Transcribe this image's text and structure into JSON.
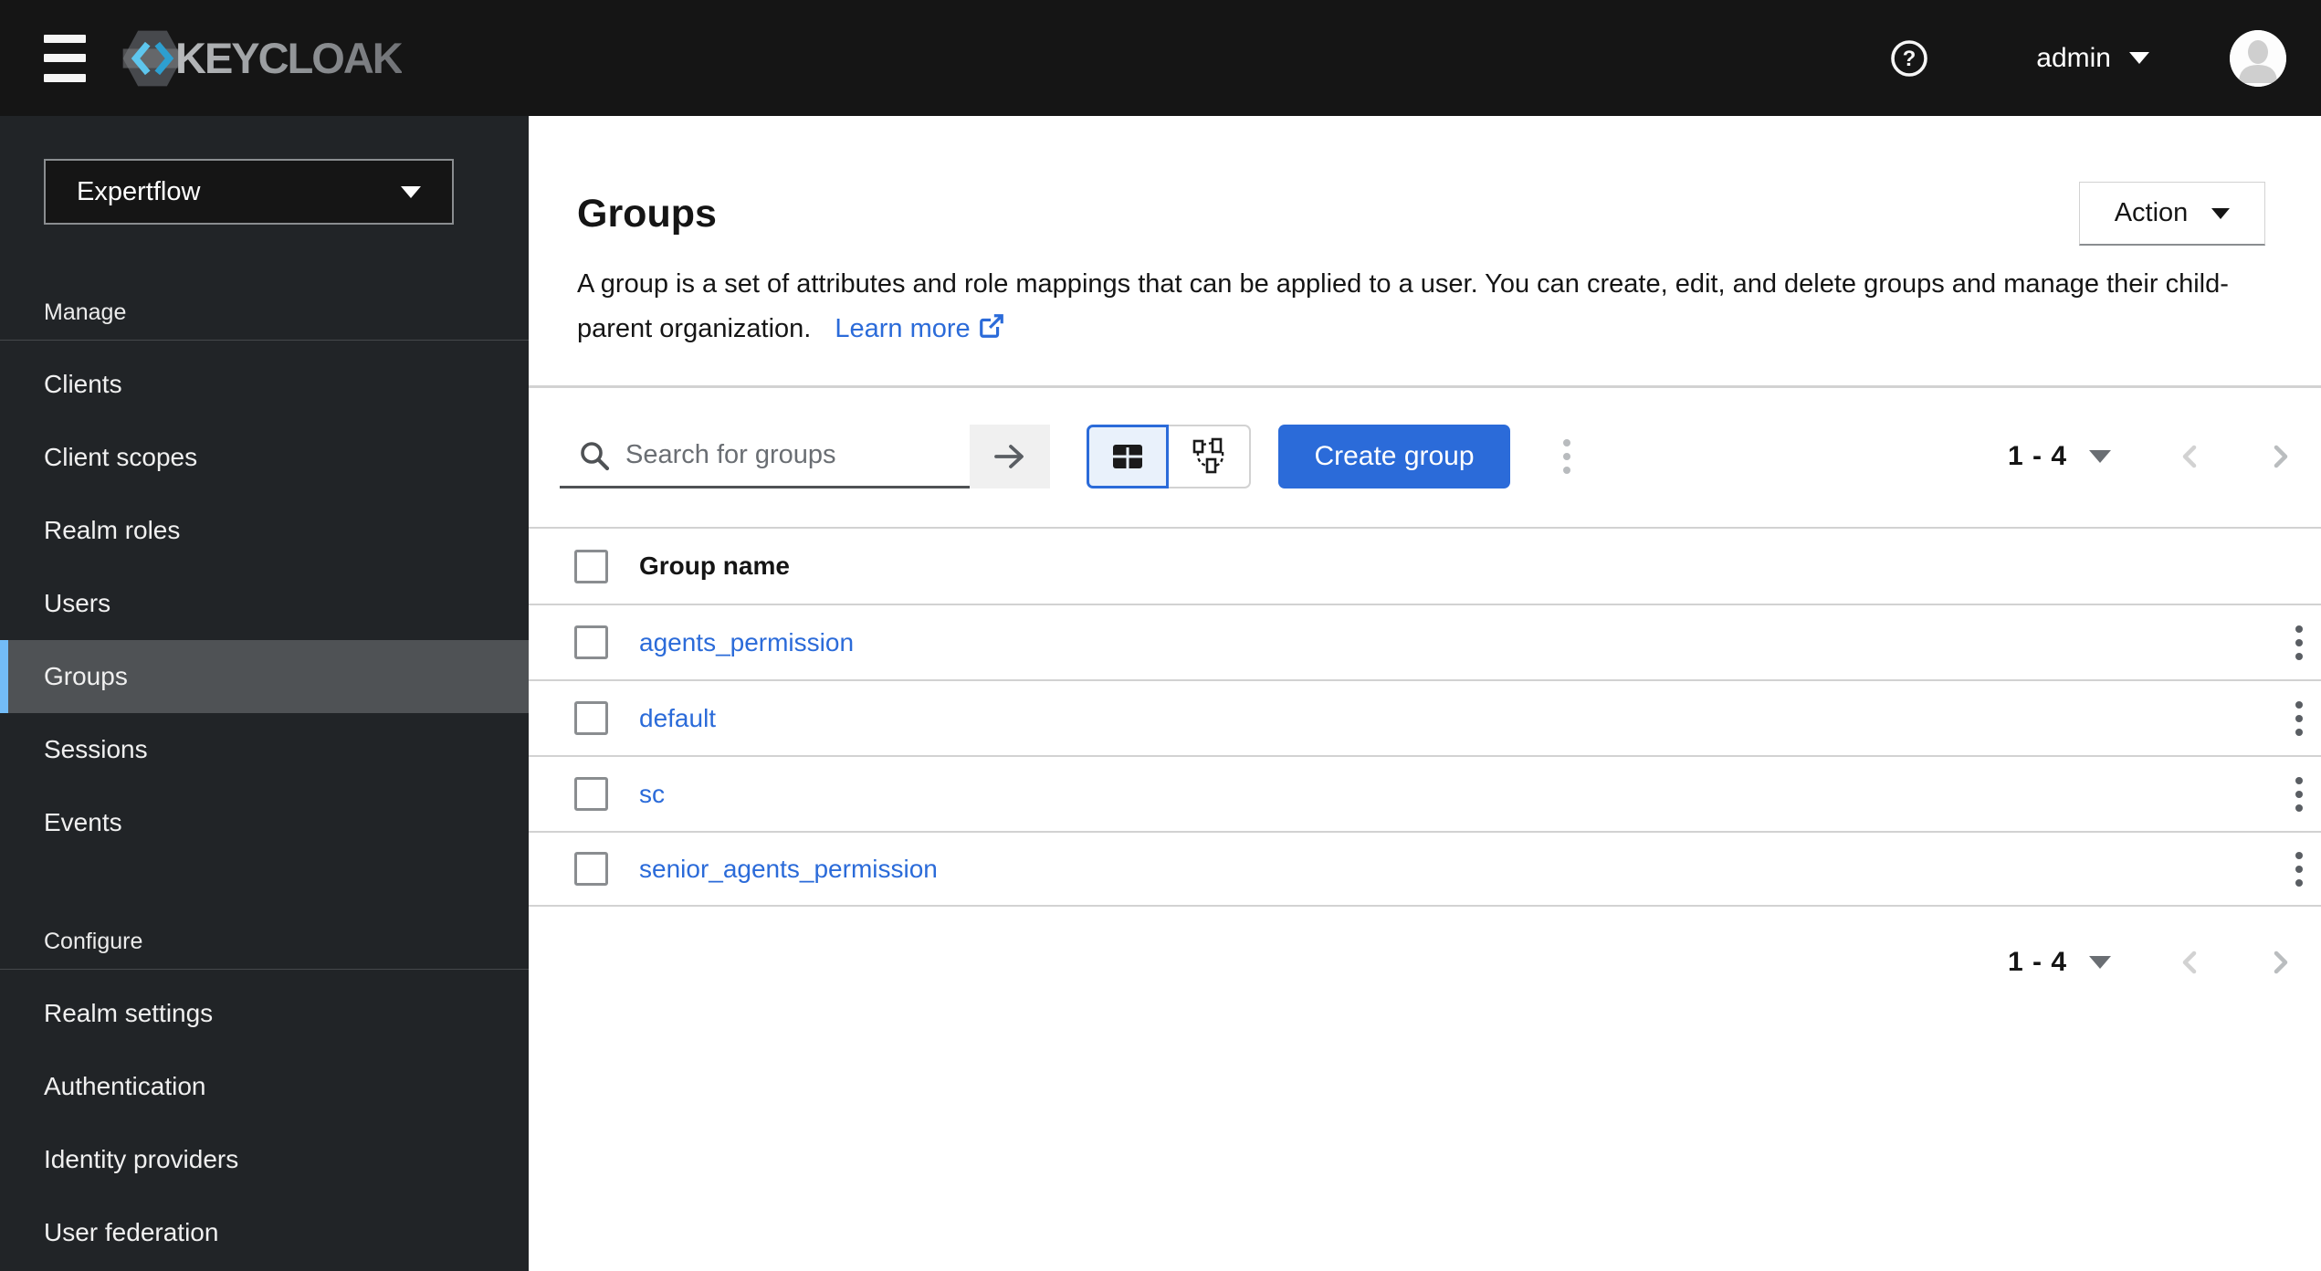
{
  "banner": {
    "product": "KEYCLOAK",
    "user": "admin"
  },
  "sidebar": {
    "realm": "Expertflow",
    "sections": [
      {
        "label": "Manage",
        "items": [
          {
            "label": "Clients",
            "selected": false
          },
          {
            "label": "Client scopes",
            "selected": false
          },
          {
            "label": "Realm roles",
            "selected": false
          },
          {
            "label": "Users",
            "selected": false
          },
          {
            "label": "Groups",
            "selected": true
          },
          {
            "label": "Sessions",
            "selected": false
          },
          {
            "label": "Events",
            "selected": false
          }
        ]
      },
      {
        "label": "Configure",
        "items": [
          {
            "label": "Realm settings",
            "selected": false
          },
          {
            "label": "Authentication",
            "selected": false
          },
          {
            "label": "Identity providers",
            "selected": false
          },
          {
            "label": "User federation",
            "selected": false
          }
        ]
      }
    ]
  },
  "main": {
    "title": "Groups",
    "action_label": "Action",
    "description": "A group is a set of attributes and role mappings that can be applied to a user. You can create, edit, and delete groups and manage their child-parent organization.",
    "learn_more_label": "Learn more",
    "toolbar": {
      "search_placeholder": "Search for groups",
      "create_label": "Create group"
    },
    "pagination": "1 - 4",
    "table": {
      "name_header": "Group name",
      "rows": [
        {
          "name": "agents_permission"
        },
        {
          "name": "default"
        },
        {
          "name": "sc"
        },
        {
          "name": "senior_agents_permission"
        }
      ]
    }
  },
  "colors": {
    "accent_blue": "#2b6bd9",
    "nav_selected_indicator": "#73bcf7",
    "banner_bg": "#151515",
    "sidebar_bg": "#212427",
    "divider": "#d2d2d2"
  }
}
